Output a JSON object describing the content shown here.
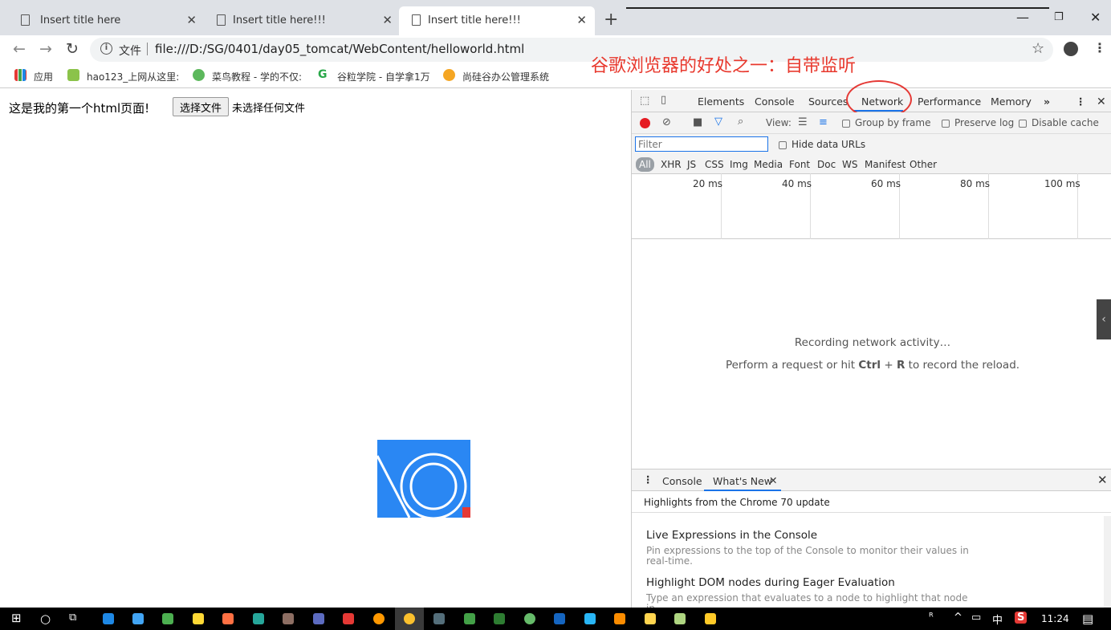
{
  "browser": {
    "tabs": [
      {
        "title": "Insert title here",
        "active": false
      },
      {
        "title": "Insert title here!!!",
        "active": false
      },
      {
        "title": "Insert title here!!!",
        "active": true
      }
    ],
    "file_label": "文件",
    "url": "file:///D:/SG/0401/day05_tomcat/WebContent/helloworld.html",
    "bookmarks": [
      {
        "label": "应用",
        "icon": "apps-grid-icon"
      },
      {
        "label": "hao123_上网从这里:",
        "icon": "hao123-icon"
      },
      {
        "label": "菜鸟教程 - 学的不仅:",
        "icon": "runoob-icon"
      },
      {
        "label": "谷粒学院 - 自学拿1万",
        "icon": "guli-icon"
      },
      {
        "label": "尚硅谷办公管理系统",
        "icon": "atguigu-icon"
      }
    ],
    "annotation": "谷歌浏览器的好处之一：自带监听"
  },
  "page": {
    "text": "这是我的第一个html页面!",
    "choose_file_button": "选择文件",
    "no_file_text": "未选择任何文件"
  },
  "devtools": {
    "tabs": [
      "Elements",
      "Console",
      "Sources",
      "Network",
      "Performance",
      "Memory"
    ],
    "active_tab": "Network",
    "more_tabs": "»",
    "toolbar": {
      "view_label": "View:",
      "group_by_frame": "Group by frame",
      "preserve_log": "Preserve log",
      "disable_cache": "Disable cache"
    },
    "filter_placeholder": "Filter",
    "hide_data_urls": "Hide data URLs",
    "type_filters": [
      "All",
      "XHR",
      "JS",
      "CSS",
      "Img",
      "Media",
      "Font",
      "Doc",
      "WS",
      "Manifest",
      "Other"
    ],
    "timeline_ticks": [
      "20 ms",
      "40 ms",
      "60 ms",
      "80 ms",
      "100 ms"
    ],
    "recording_text": "Recording network activity…",
    "perform_text_before": "Perform a request or hit ",
    "perform_ctrl": "Ctrl",
    "perform_plus": " + ",
    "perform_r": "R",
    "perform_text_after": " to record the reload.",
    "drawer": {
      "tabs": [
        "Console",
        "What's New"
      ],
      "active": "What's New",
      "headline": "Highlights from the Chrome 70 update",
      "items": [
        {
          "title": "Live Expressions in the Console",
          "desc": "Pin expressions to the top of the Console to monitor their values in real-time."
        },
        {
          "title": "Highlight DOM nodes during Eager Evaluation",
          "desc": "Type an expression that evaluates to a node to highlight that node in"
        }
      ]
    }
  },
  "taskbar": {
    "clock": "11:24",
    "tray": [
      "^",
      "中",
      "S"
    ]
  },
  "colors": {
    "accent": "#1a73e8",
    "record_red": "#e51c23",
    "annotation_red": "#e8392e",
    "tabstrip": "#dee1e6"
  }
}
